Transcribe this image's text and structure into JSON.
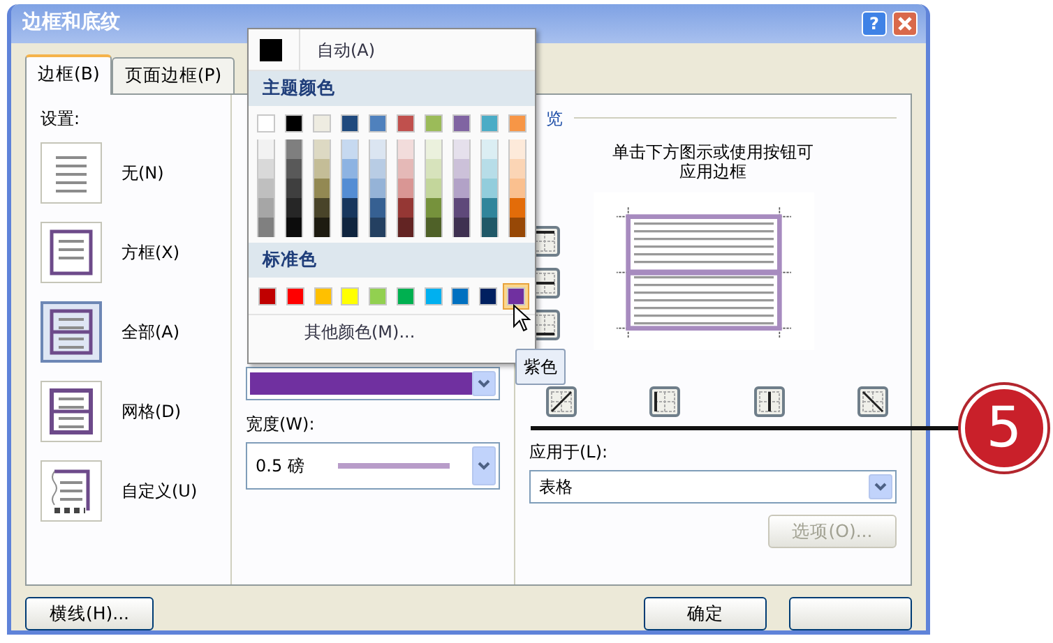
{
  "window": {
    "title": "边框和底纹",
    "help_button": "?"
  },
  "tabs": [
    {
      "label": "边框(B)",
      "selected": true
    },
    {
      "label": "页面边框(P)",
      "selected": false
    }
  ],
  "settings": {
    "label": "设置:",
    "items": [
      {
        "kind": "none",
        "label": "无(N)",
        "selected": false
      },
      {
        "kind": "box",
        "label": "方框(X)",
        "selected": false
      },
      {
        "kind": "all",
        "label": "全部(A)",
        "selected": true
      },
      {
        "kind": "grid",
        "label": "网格(D)",
        "selected": false
      },
      {
        "kind": "custom",
        "label": "自定义(U)",
        "selected": false
      }
    ]
  },
  "color_menu": {
    "auto_label": "自动(A)",
    "theme_header": "主题颜色",
    "theme_colors": [
      {
        "color": "#ffffff",
        "shades": [
          {
            "color": "#f2f2f2"
          },
          {
            "color": "#d9d9d9"
          },
          {
            "color": "#bfbfbf"
          },
          {
            "color": "#a6a6a6"
          },
          {
            "color": "#808080"
          }
        ]
      },
      {
        "color": "#000000",
        "shades": [
          {
            "color": "#7f7f7f"
          },
          {
            "color": "#595959"
          },
          {
            "color": "#3f3f3f"
          },
          {
            "color": "#262626"
          },
          {
            "color": "#0c0c0c"
          }
        ]
      },
      {
        "color": "#eeece1",
        "shades": [
          {
            "color": "#ddd9c3"
          },
          {
            "color": "#c4bd97"
          },
          {
            "color": "#938953"
          },
          {
            "color": "#494429"
          },
          {
            "color": "#1d1b10"
          }
        ]
      },
      {
        "color": "#1f497d",
        "shades": [
          {
            "color": "#c6d9f0"
          },
          {
            "color": "#8db3e2"
          },
          {
            "color": "#548dd4"
          },
          {
            "color": "#17365d"
          },
          {
            "color": "#0f243e"
          }
        ]
      },
      {
        "color": "#4f81bd",
        "shades": [
          {
            "color": "#dbe5f1"
          },
          {
            "color": "#b8cce4"
          },
          {
            "color": "#95b3d7"
          },
          {
            "color": "#366092"
          },
          {
            "color": "#244061"
          }
        ]
      },
      {
        "color": "#c0504d",
        "shades": [
          {
            "color": "#f2dcdb"
          },
          {
            "color": "#e5b9b7"
          },
          {
            "color": "#d99694"
          },
          {
            "color": "#953734"
          },
          {
            "color": "#632423"
          }
        ]
      },
      {
        "color": "#9bbb59",
        "shades": [
          {
            "color": "#ebf1dd"
          },
          {
            "color": "#d7e3bc"
          },
          {
            "color": "#c3d69b"
          },
          {
            "color": "#76923c"
          },
          {
            "color": "#4f6128"
          }
        ]
      },
      {
        "color": "#8064a2",
        "shades": [
          {
            "color": "#e5e0ec"
          },
          {
            "color": "#ccc1d9"
          },
          {
            "color": "#b2a2c7"
          },
          {
            "color": "#5f497a"
          },
          {
            "color": "#3f3151"
          }
        ]
      },
      {
        "color": "#4bacc6",
        "shades": [
          {
            "color": "#dbeef3"
          },
          {
            "color": "#b7dde8"
          },
          {
            "color": "#92cddc"
          },
          {
            "color": "#31859b"
          },
          {
            "color": "#205867"
          }
        ]
      },
      {
        "color": "#f79646",
        "shades": [
          {
            "color": "#fdeada"
          },
          {
            "color": "#fbd5b5"
          },
          {
            "color": "#fac08f"
          },
          {
            "color": "#e36c09"
          },
          {
            "color": "#974806"
          }
        ]
      }
    ],
    "standard_header": "标准色",
    "standard_colors": [
      {
        "color": "#c00000",
        "selected": false
      },
      {
        "color": "#ff0000",
        "selected": false
      },
      {
        "color": "#ffc000",
        "selected": false
      },
      {
        "color": "#ffff00",
        "selected": false
      },
      {
        "color": "#92d050",
        "selected": false
      },
      {
        "color": "#00b050",
        "selected": false
      },
      {
        "color": "#00b0f0",
        "selected": false
      },
      {
        "color": "#0070c0",
        "selected": false
      },
      {
        "color": "#002060",
        "selected": false
      },
      {
        "color": "#7030a0",
        "selected": true
      }
    ],
    "more_colors": "其他颜色(M)...",
    "tooltip": "紫色"
  },
  "color_field": {
    "color": "#7030a0"
  },
  "width_field": {
    "label": "宽度(W):",
    "value": "0.5 磅"
  },
  "preview": {
    "label": "览",
    "hint": "单击下方图示或使用按钮可应用边框"
  },
  "apply_to": {
    "label": "应用于(L):",
    "value": "表格"
  },
  "options_button": {
    "label": "选项(O)...",
    "disabled": true
  },
  "horizontal_line_button": "横线(H)...",
  "ok_button": "确定",
  "callout": {
    "number": "5"
  }
}
